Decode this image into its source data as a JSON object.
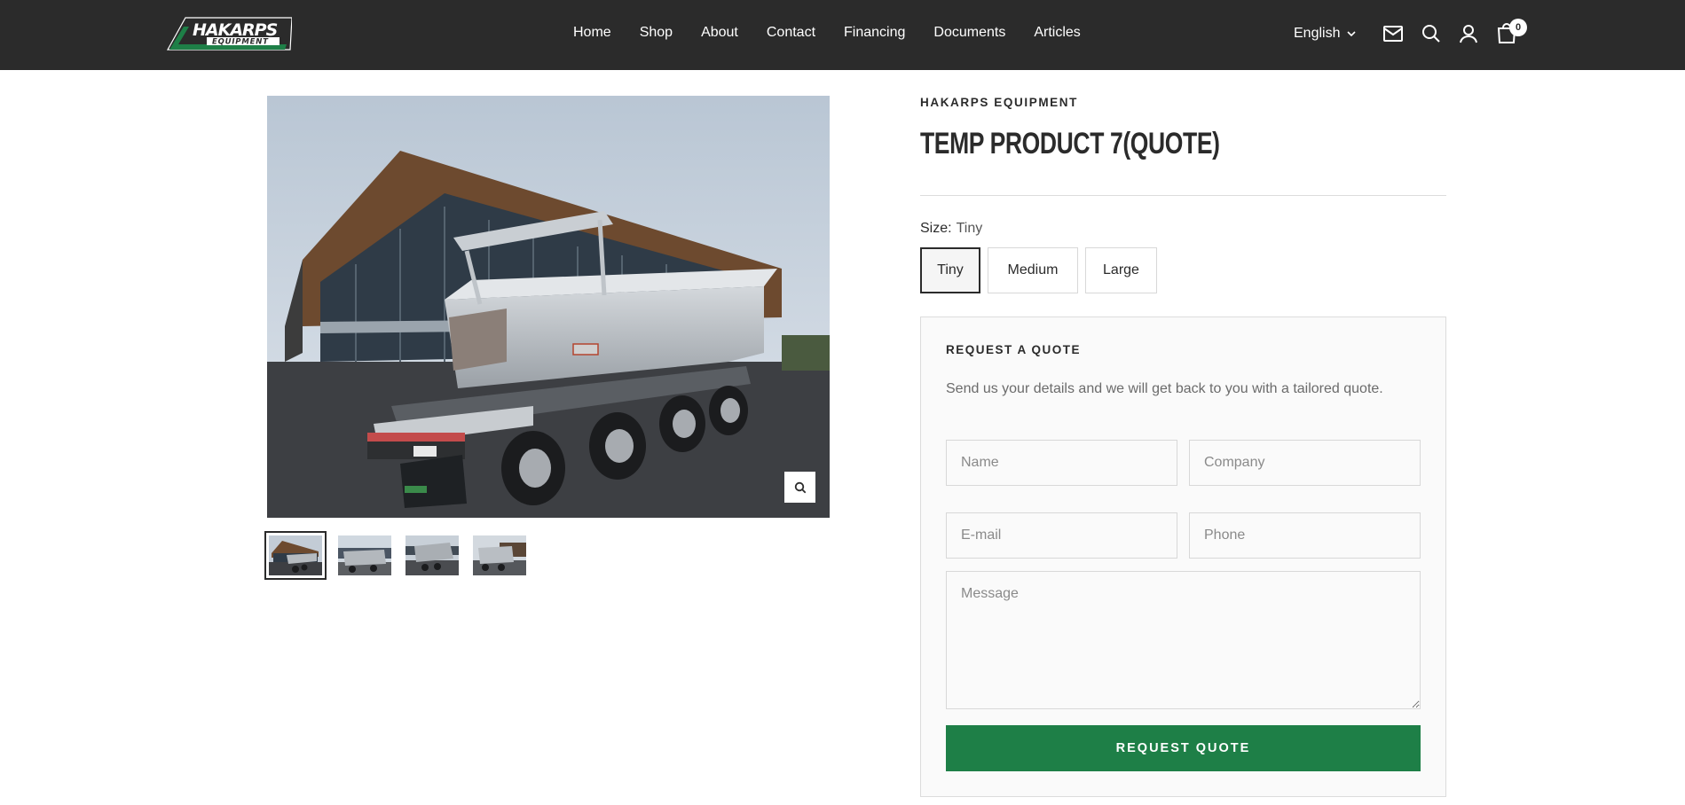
{
  "header": {
    "logo_text": "HAKARPS",
    "logo_subtext": "EQUIPMENT",
    "nav": [
      {
        "label": "Home"
      },
      {
        "label": "Shop"
      },
      {
        "label": "About"
      },
      {
        "label": "Contact"
      },
      {
        "label": "Financing"
      },
      {
        "label": "Documents"
      },
      {
        "label": "Articles"
      }
    ],
    "language": "English",
    "cart_count": "0",
    "icons": [
      "mail-icon",
      "search-icon",
      "account-icon",
      "cart-icon"
    ]
  },
  "gallery": {
    "zoom_icon": "magnifier-icon",
    "thumbnail_count": 4,
    "active_thumbnail": 1
  },
  "product": {
    "vendor": "HAKARPS EQUIPMENT",
    "title": "TEMP PRODUCT 7(QUOTE)",
    "size_label": "Size:",
    "size_value": "Tiny",
    "sizes": [
      {
        "label": "Tiny",
        "selected": true
      },
      {
        "label": "Medium",
        "selected": false
      },
      {
        "label": "Large",
        "selected": false
      }
    ]
  },
  "quote": {
    "title": "REQUEST A QUOTE",
    "description": "Send us your details and we will get back to you with a tailored quote.",
    "fields": {
      "name_placeholder": "Name",
      "company_placeholder": "Company",
      "email_placeholder": "E-mail",
      "phone_placeholder": "Phone",
      "message_placeholder": "Message"
    },
    "submit_label": "REQUEST QUOTE"
  },
  "colors": {
    "header_bg": "#2b2b2b",
    "brand_green": "#1e7f47",
    "text": "#2b2b2b"
  }
}
